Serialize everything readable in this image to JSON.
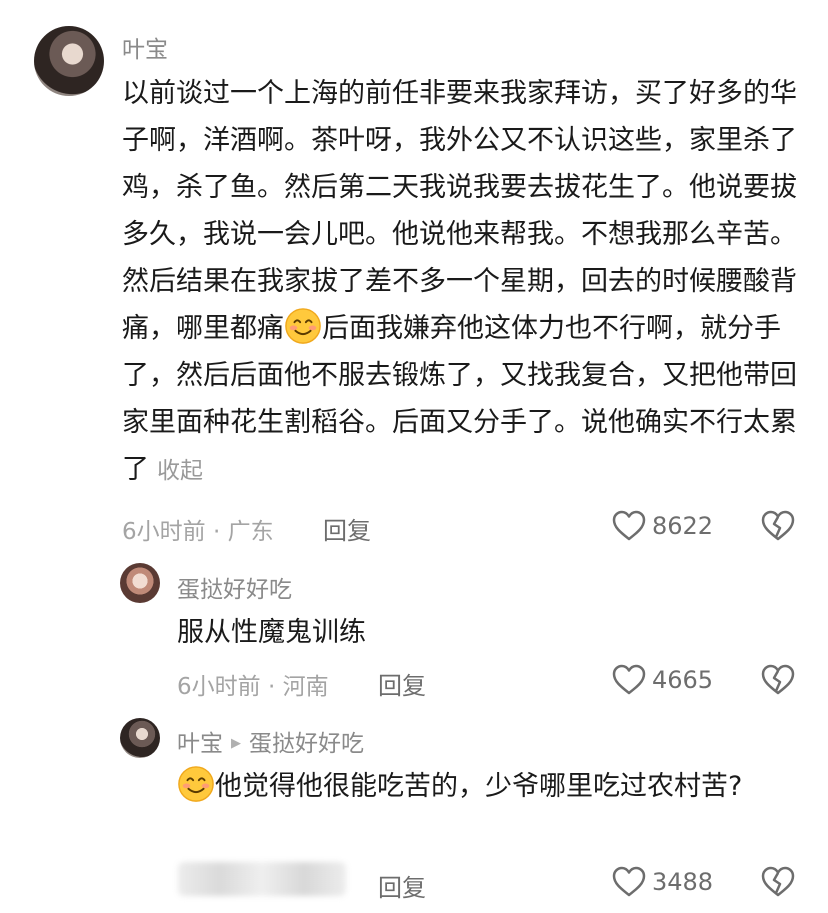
{
  "comments": [
    {
      "username": "叶宝",
      "text_before_emoji": "以前谈过一个上海的前任非要来我家拜访，买了好多的华子啊，洋酒啊。茶叶呀，我外公又不认识这些，家里杀了鸡，杀了鱼。然后第二天我说我要去拔花生了。他说要拔多久，我说一会儿吧。他说他来帮我。不想我那么辛苦。然后结果在我家拔了差不多一个星期，回去的时候腰酸背痛，哪里都痛",
      "text_after_emoji": "后面我嫌弃他这体力也不行啊，就分手了，然后后面他不服去锻炼了，又找我复合，又把他带回家里面种花生割稻谷。后面又分手了。说他确实不行太累了",
      "collapse_label": "收起",
      "meta": "6小时前 · 广东",
      "reply_label": "回复",
      "likes": "8622"
    },
    {
      "username": "蛋挞好好吃",
      "text": "服从性魔鬼训练",
      "meta": "6小时前 · 河南",
      "reply_label": "回复",
      "likes": "4665"
    },
    {
      "username": "叶宝",
      "reply_to": "蛋挞好好吃",
      "text": "他觉得他很能吃苦的，少爷哪里吃过农村苦?",
      "reply_label": "回复",
      "likes": "3488"
    }
  ],
  "icons": {
    "like": "heart-outline-icon",
    "dislike": "broken-heart-icon",
    "emoji": "smile-emoji-icon",
    "reply_arrow": "play-triangle-icon"
  },
  "colors": {
    "text": "#1a1a1a",
    "username": "#8a8a8a",
    "meta": "#a4a4a4",
    "action": "#6d6d6d"
  }
}
